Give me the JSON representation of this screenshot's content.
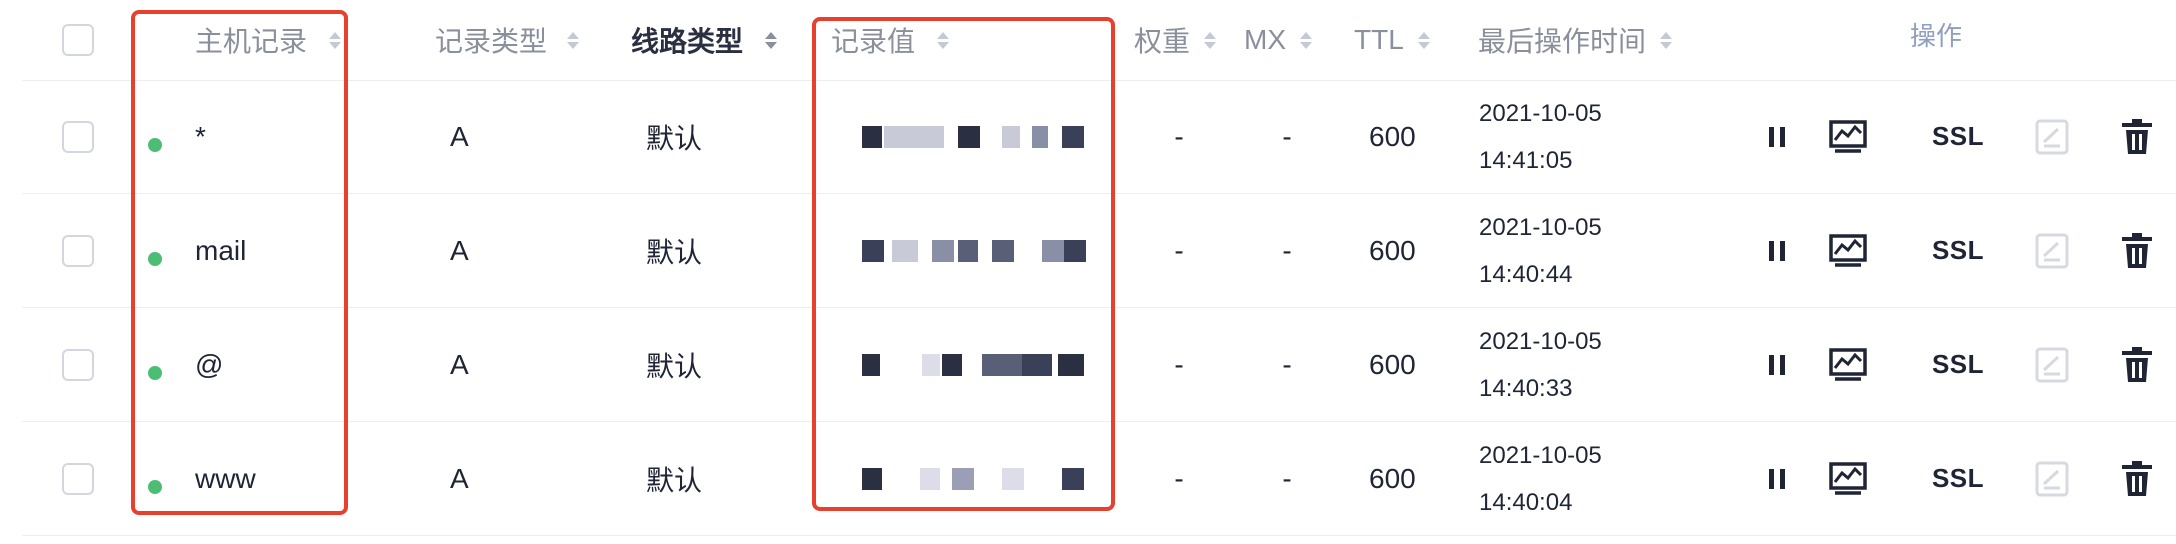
{
  "table": {
    "columns": [
      {
        "key": "host",
        "label": "主机记录"
      },
      {
        "key": "type",
        "label": "记录类型"
      },
      {
        "key": "line",
        "label": "线路类型"
      },
      {
        "key": "value",
        "label": "记录值"
      },
      {
        "key": "weight",
        "label": "权重"
      },
      {
        "key": "mx",
        "label": "MX"
      },
      {
        "key": "ttl",
        "label": "TTL"
      },
      {
        "key": "updated",
        "label": "最后操作时间"
      },
      {
        "key": "ops",
        "label": "操作"
      }
    ],
    "rows": [
      {
        "status": "enabled",
        "host": "*",
        "type": "A",
        "line": "默认",
        "value_text": "",
        "value_redacted": true,
        "weight": "-",
        "mx": "-",
        "ttl": "600",
        "date": "2021-10-05",
        "time": "14:41:05"
      },
      {
        "status": "enabled",
        "host": "mail",
        "type": "A",
        "line": "默认",
        "value_text": "",
        "value_redacted": true,
        "weight": "-",
        "mx": "-",
        "ttl": "600",
        "date": "2021-10-05",
        "time": "14:40:44"
      },
      {
        "status": "enabled",
        "host": "@",
        "type": "A",
        "line": "默认",
        "value_text": "",
        "value_redacted": true,
        "weight": "-",
        "mx": "-",
        "ttl": "600",
        "date": "2021-10-05",
        "time": "14:40:33"
      },
      {
        "status": "enabled",
        "host": "www",
        "type": "A",
        "line": "默认",
        "value_text": "",
        "value_redacted": true,
        "weight": "-",
        "mx": "-",
        "ttl": "600",
        "date": "2021-10-05",
        "time": "14:40:04"
      }
    ],
    "actions": {
      "pause_icon": "pause-icon",
      "monitor_icon": "monitor-icon",
      "ssl_label": "SSL",
      "edit_icon": "edit-icon",
      "delete_icon": "trash-icon"
    }
  },
  "colors": {
    "status_enabled": "#4cbe74",
    "highlight_box": "#e8402f",
    "ops_header": "#8f9fbd",
    "edit_disabled": "#d6d9e0"
  }
}
